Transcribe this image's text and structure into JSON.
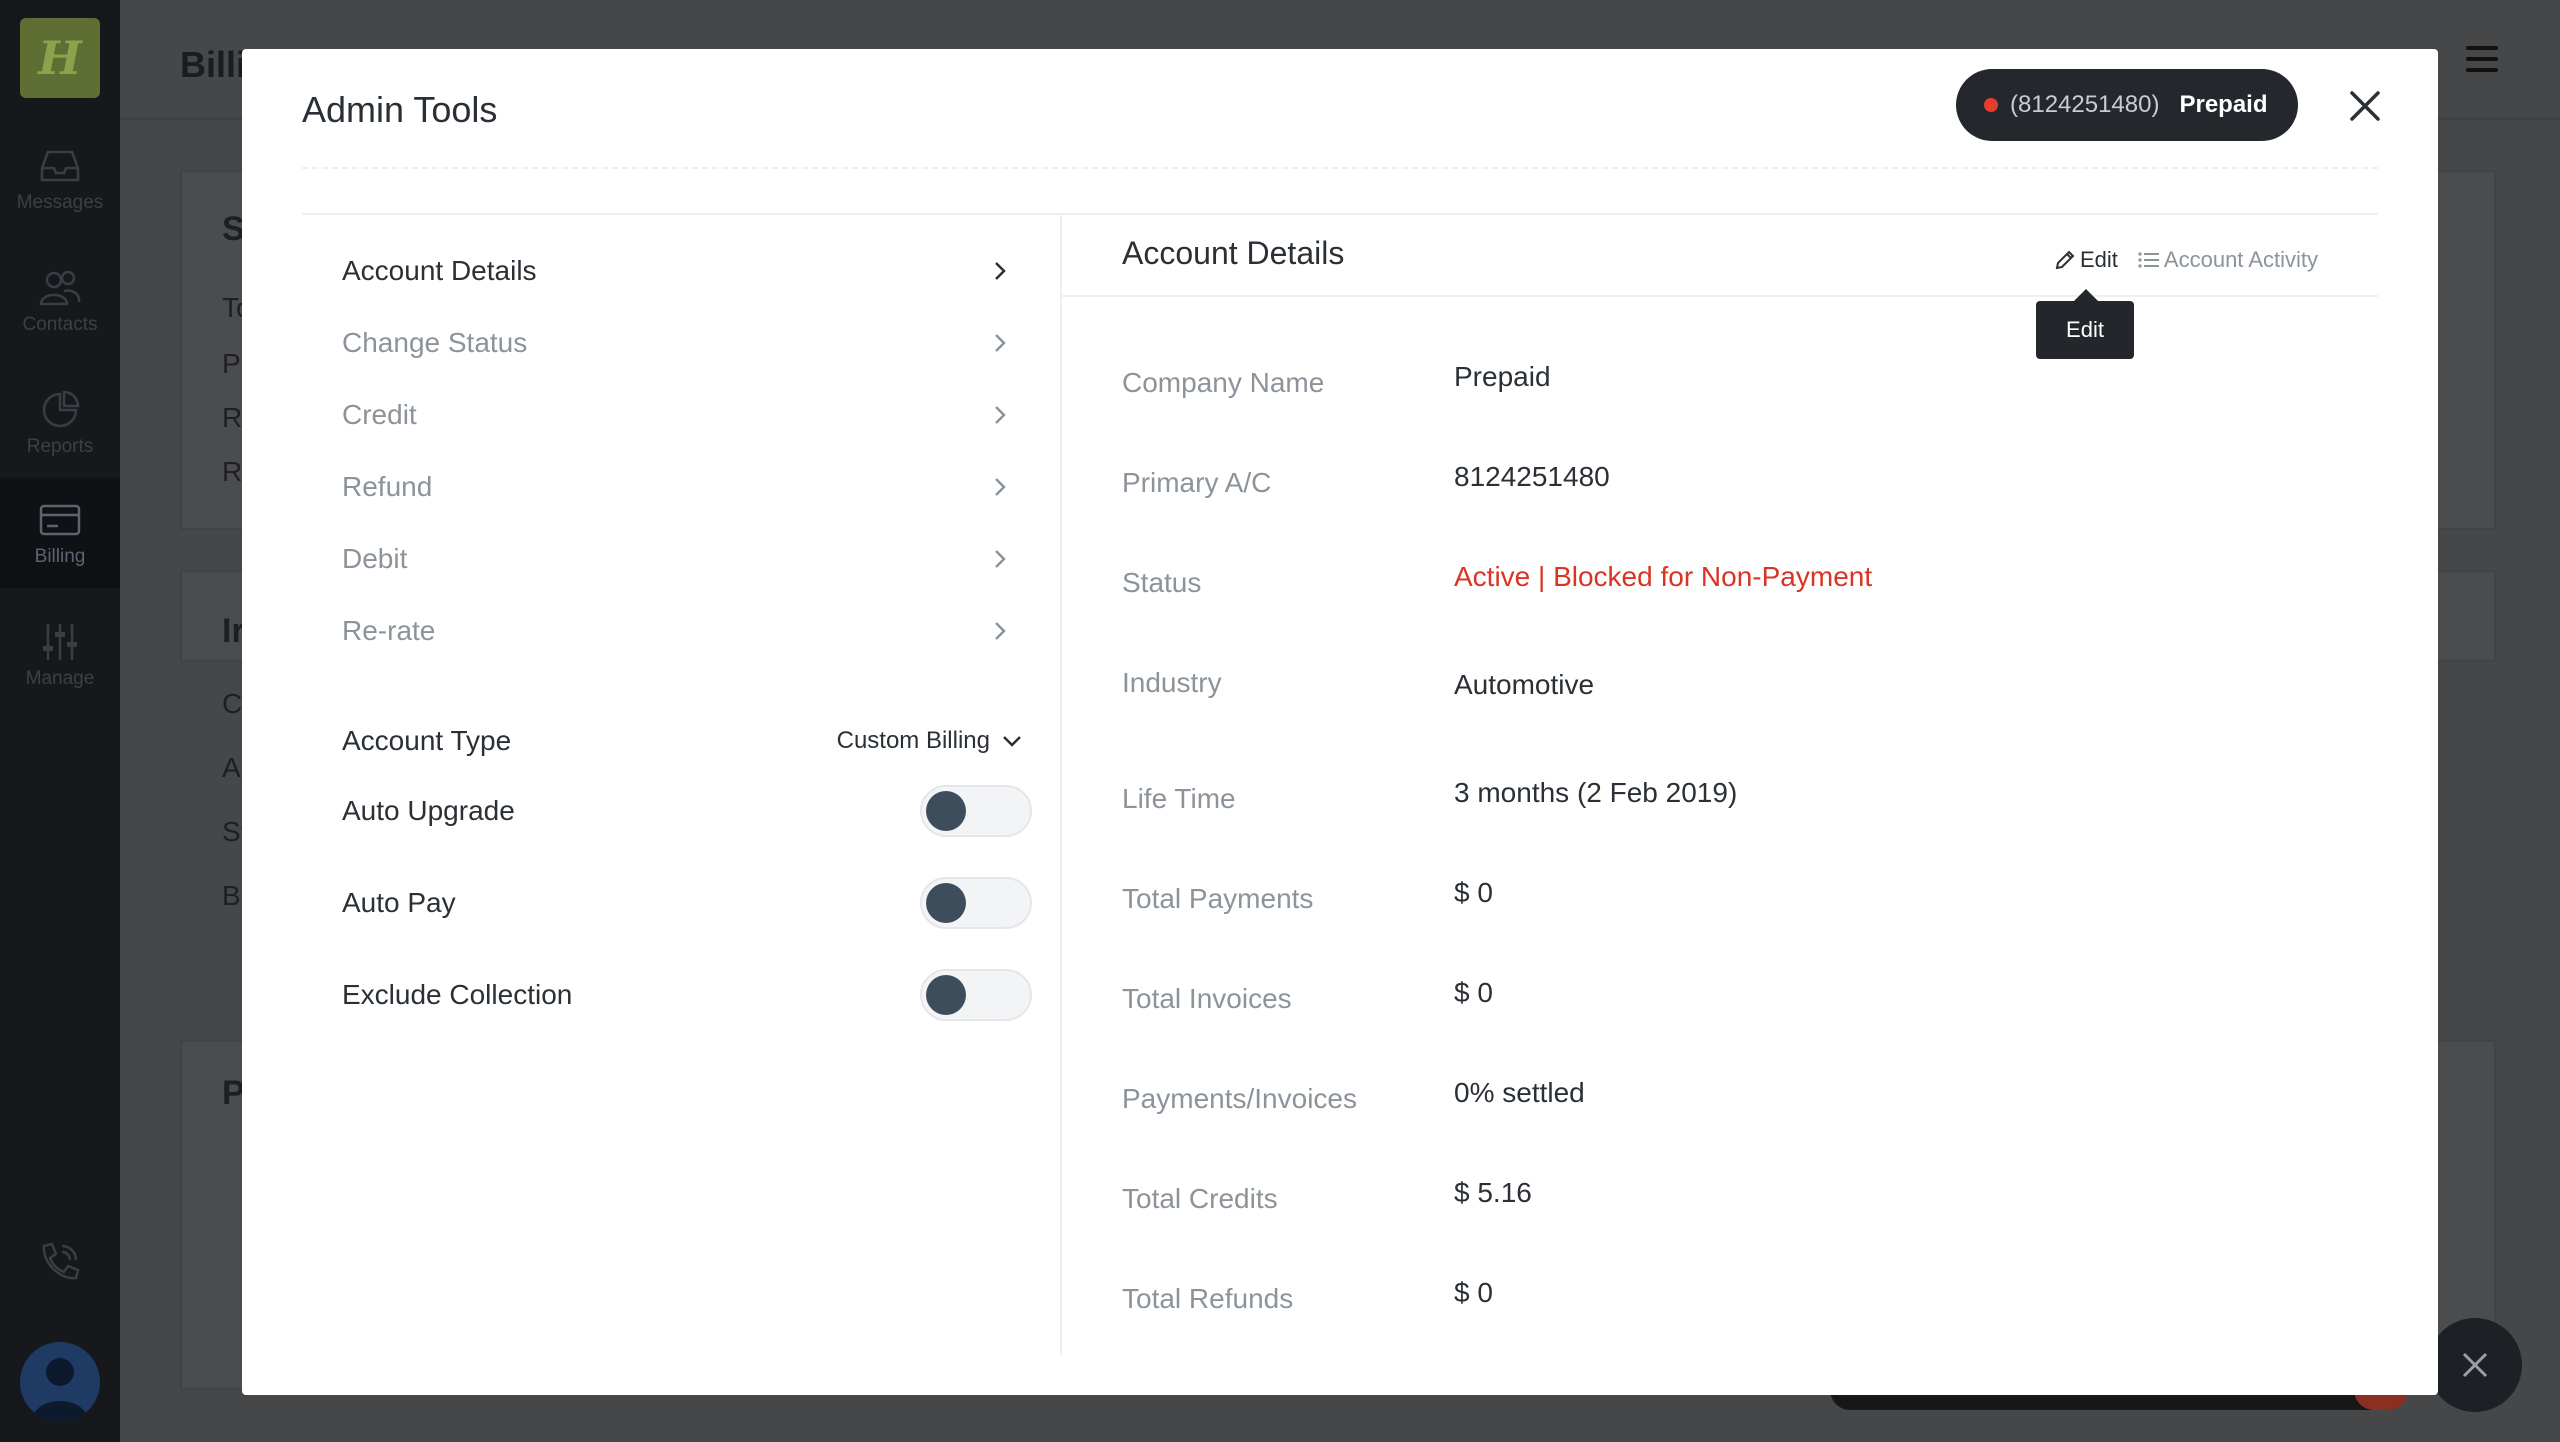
{
  "background": {
    "page_title": "Billi",
    "card_letters": [
      "S",
      "To",
      "Pi",
      "Ri",
      "Ri",
      "Ir",
      "C",
      "A",
      "St",
      "Bi",
      "P"
    ],
    "nav": [
      {
        "label": "Messages"
      },
      {
        "label": "Contacts"
      },
      {
        "label": "Reports"
      },
      {
        "label": "Billing"
      },
      {
        "label": "Manage"
      }
    ],
    "logo_letter": "H"
  },
  "modal": {
    "title": "Admin Tools",
    "account_badge": {
      "number": "(8124251480)",
      "plan": "Prepaid"
    },
    "menu": [
      {
        "label": "Account Details"
      },
      {
        "label": "Change Status"
      },
      {
        "label": "Credit"
      },
      {
        "label": "Refund"
      },
      {
        "label": "Debit"
      },
      {
        "label": "Re-rate"
      }
    ],
    "account_type": {
      "label": "Account Type",
      "value": "Custom Billing"
    },
    "toggles": [
      {
        "label": "Auto Upgrade",
        "on": false
      },
      {
        "label": "Auto Pay",
        "on": false
      },
      {
        "label": "Exclude Collection",
        "on": false
      }
    ],
    "details": {
      "title": "Account Details",
      "edit_label": "Edit",
      "activity_label": "Account Activity",
      "tooltip": "Edit",
      "fields": [
        {
          "label": "Company Name",
          "value": "Prepaid"
        },
        {
          "label": "Primary A/C",
          "value": "8124251480"
        },
        {
          "label": "Status",
          "value": "Active | Blocked for Non-Payment"
        },
        {
          "label": "Industry",
          "value": "Automotive"
        },
        {
          "label": "Life Time",
          "value": "3 months (2 Feb 2019)"
        },
        {
          "label": "Total Payments",
          "value": "$ 0"
        },
        {
          "label": "Total Invoices",
          "value": "$ 0"
        },
        {
          "label": "Payments/Invoices",
          "value": "0% settled"
        },
        {
          "label": "Total Credits",
          "value": "$ 5.16"
        },
        {
          "label": "Total Refunds",
          "value": "$ 0"
        }
      ]
    }
  },
  "colors": {
    "status_danger": "#d93425",
    "badge_bg": "#24282d",
    "badge_dot": "#e53e2e"
  }
}
